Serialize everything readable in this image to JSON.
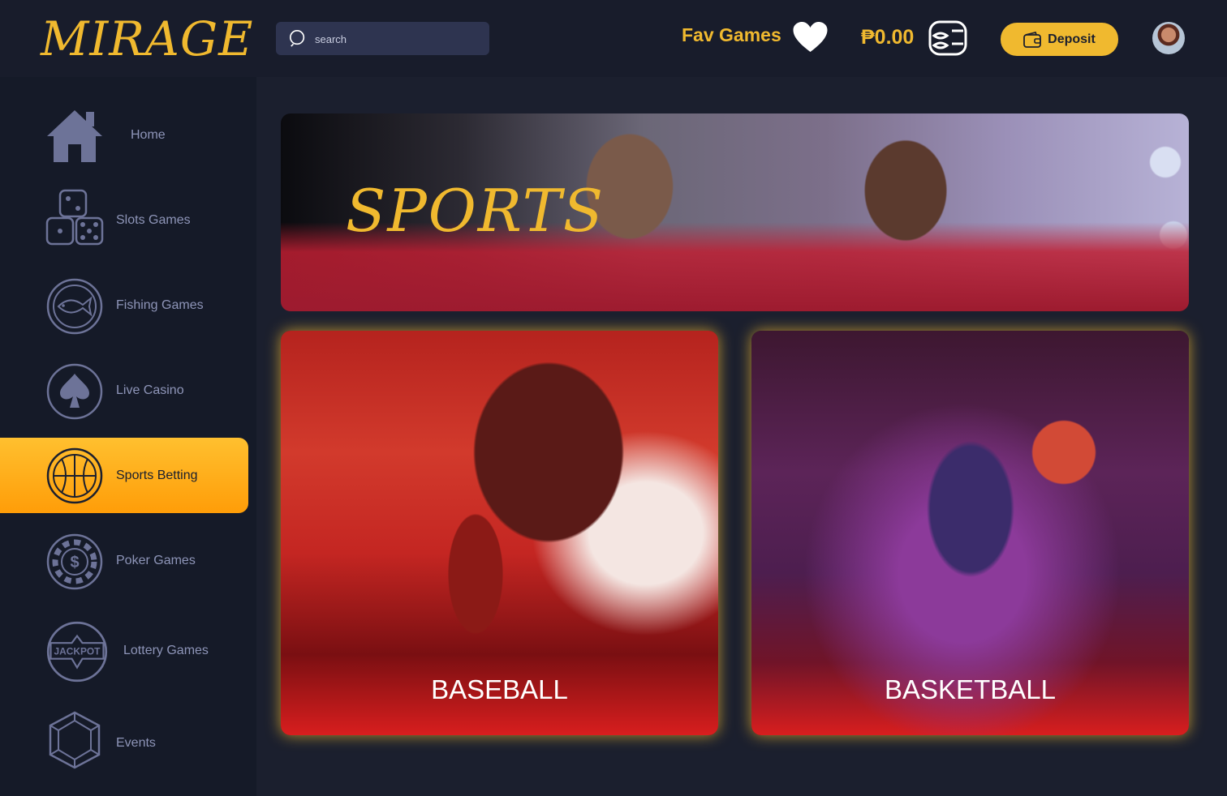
{
  "header": {
    "logo": "MIRAGE",
    "search_placeholder": "search",
    "fav_label": "Fav Games",
    "balance": "₱0.00",
    "deposit_label": "Deposit"
  },
  "sidebar": {
    "items": [
      {
        "label": "Home",
        "icon": "home-icon"
      },
      {
        "label": "Slots Games",
        "icon": "dice-icon"
      },
      {
        "label": "Fishing Games",
        "icon": "fish-icon"
      },
      {
        "label": "Live Casino",
        "icon": "spade-icon"
      },
      {
        "label": "Sports Betting",
        "icon": "basketball-icon",
        "active": true
      },
      {
        "label": "Poker Games",
        "icon": "poker-chip-icon"
      },
      {
        "label": "Lottery Games",
        "icon": "jackpot-icon"
      },
      {
        "label": "Events",
        "icon": "gem-icon"
      }
    ]
  },
  "main": {
    "banner_title": "SPORTS",
    "cards": [
      {
        "label": "BASEBALL"
      },
      {
        "label": "BASKETBALL"
      }
    ]
  },
  "colors": {
    "accent": "#f0b92f",
    "background": "#1b1f2e",
    "sidebar": "#151a28",
    "card_red": "#d81e1e"
  }
}
